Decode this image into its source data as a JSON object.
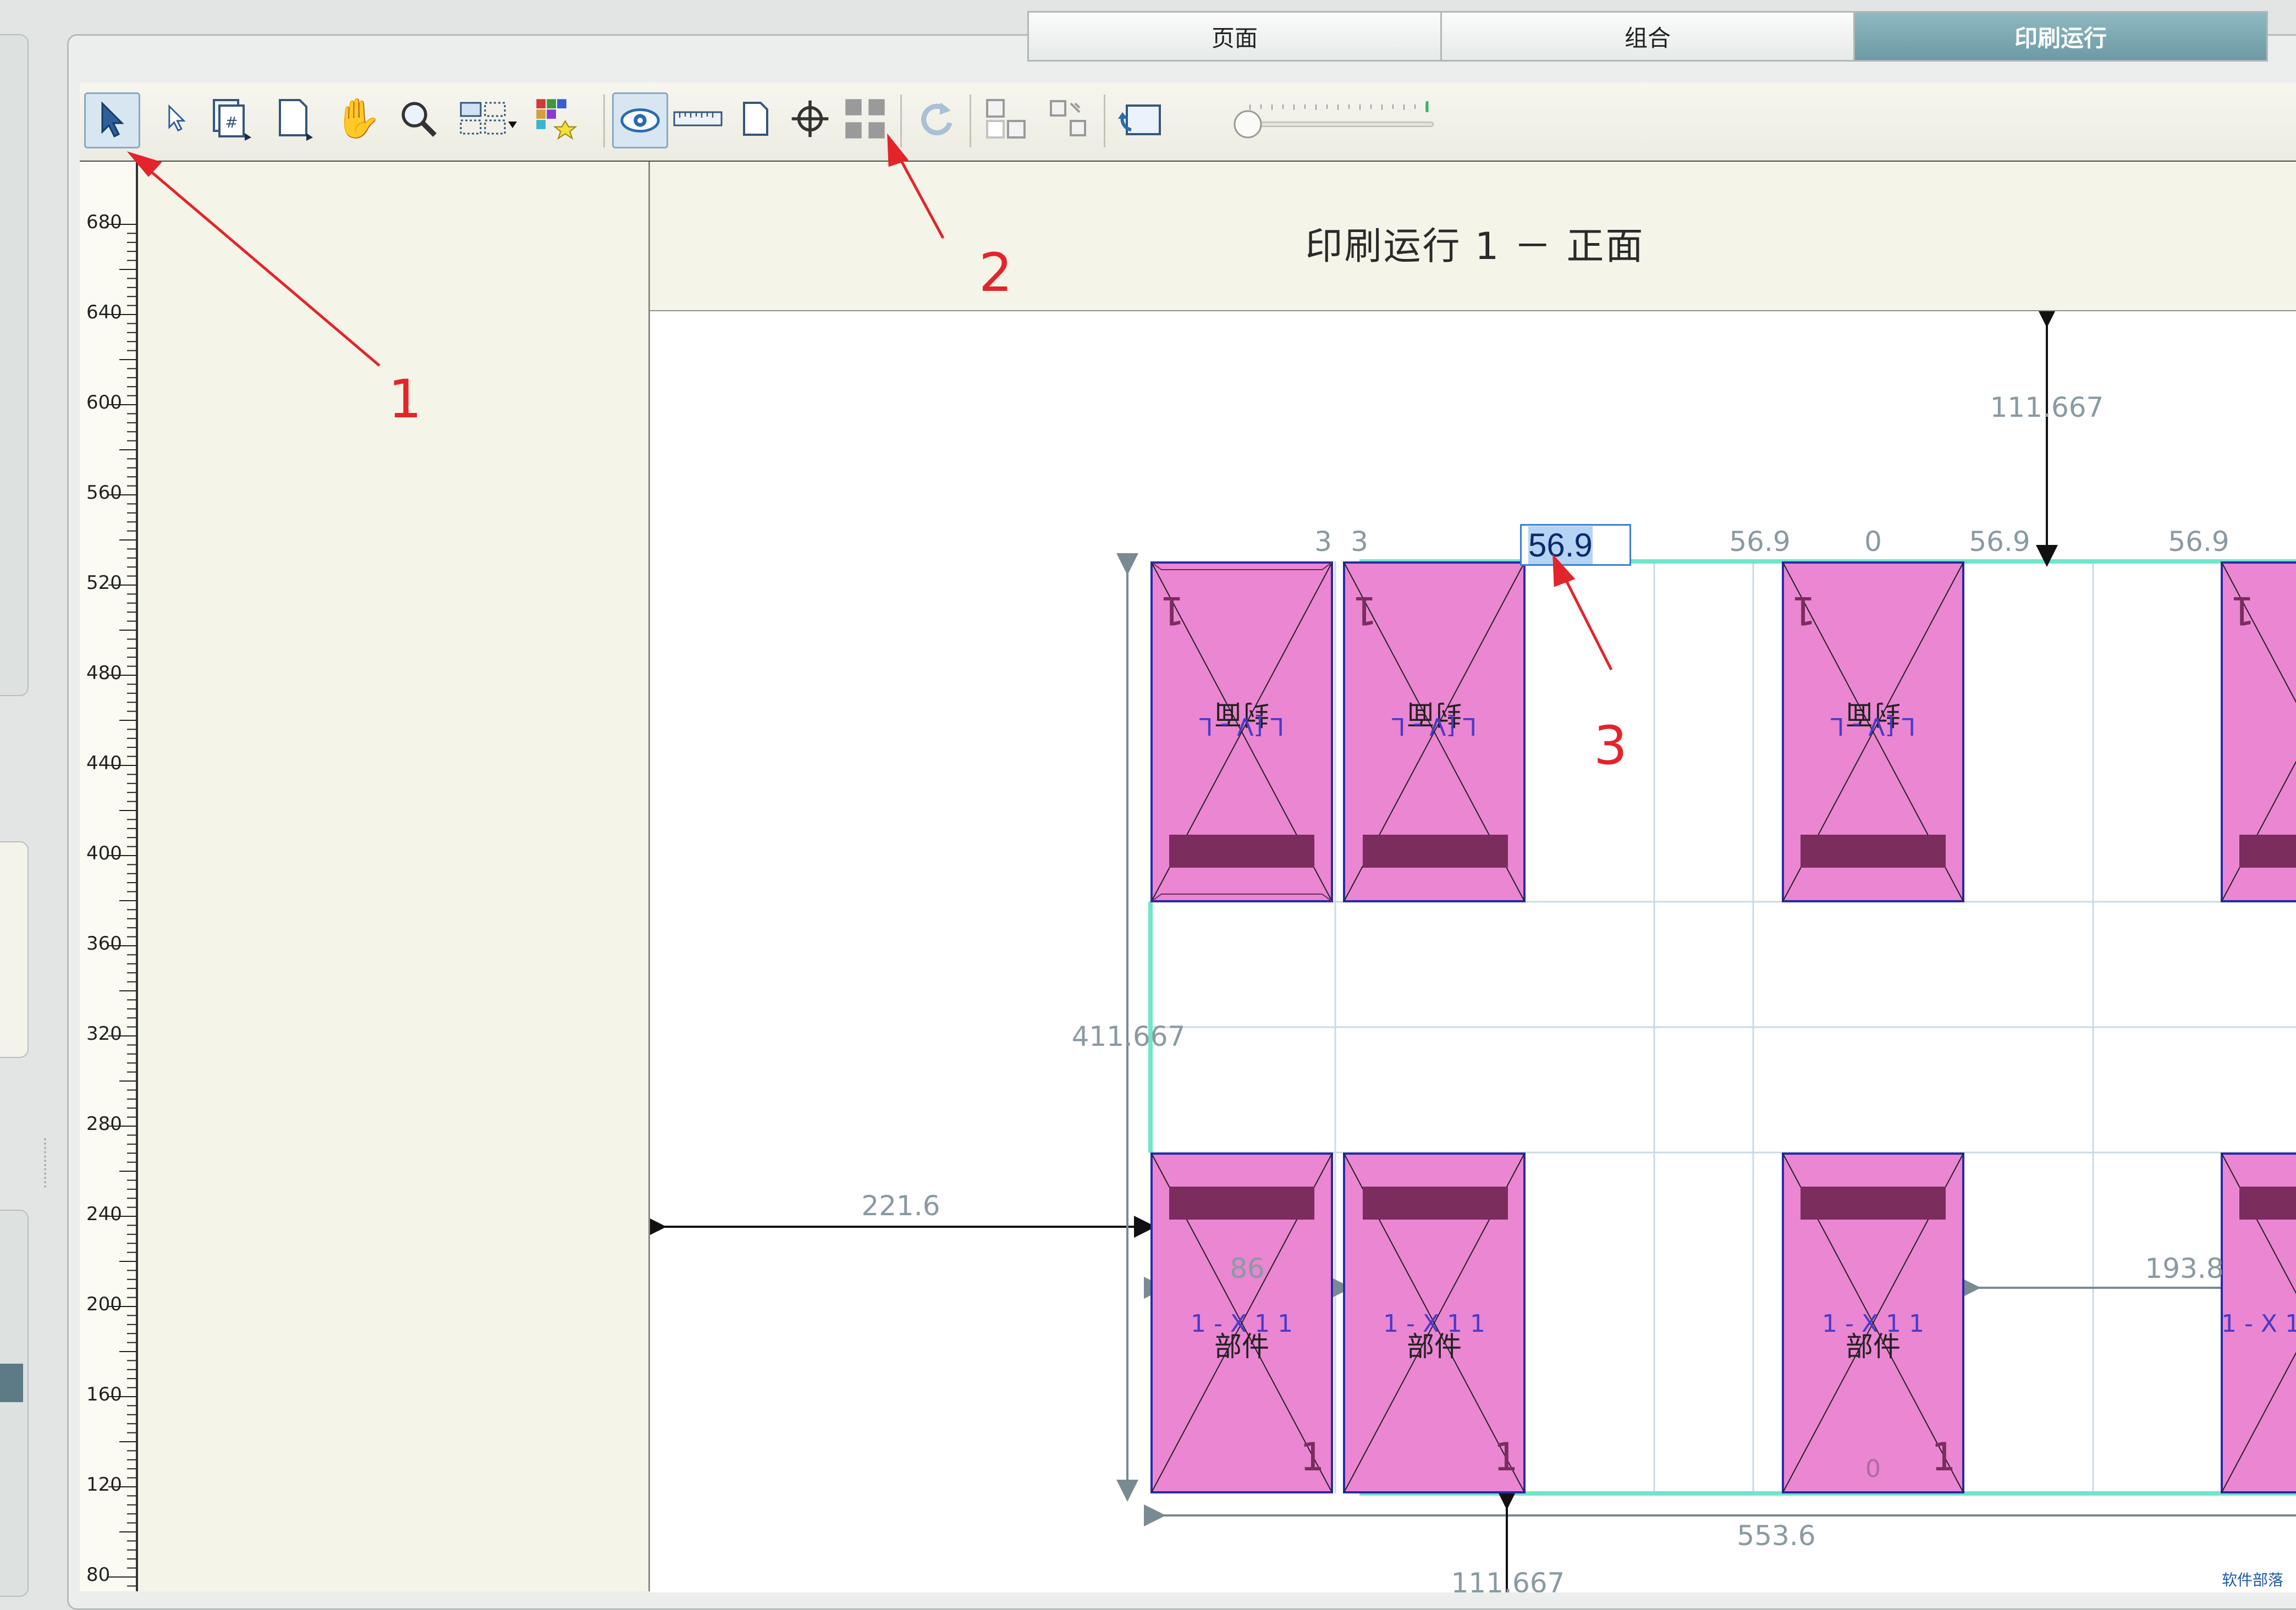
{
  "tabs": [
    {
      "label": "页面",
      "active": false
    },
    {
      "label": "组合",
      "active": false
    },
    {
      "label": "印刷运行",
      "active": true
    }
  ],
  "toolbar": {
    "tools": [
      {
        "name": "select-tool",
        "icon": "arrow-cursor-icon",
        "pressed": true
      },
      {
        "name": "direct-select-tool",
        "icon": "small-arrow-icon"
      },
      {
        "name": "page-numbering-tool",
        "icon": "page-number-icon"
      },
      {
        "name": "page-tool",
        "icon": "page-icon"
      },
      {
        "name": "hand-tool",
        "icon": "hand-icon"
      },
      {
        "name": "zoom-tool",
        "icon": "magnifier-icon"
      },
      {
        "name": "layout-grid-tool",
        "icon": "grid-dropdown-icon"
      },
      {
        "name": "color-magic-tool",
        "icon": "color-wand-icon"
      },
      {
        "name": "preview-toggle",
        "icon": "eye-icon",
        "pressed": true
      },
      {
        "name": "ruler-toggle",
        "icon": "ruler-icon"
      },
      {
        "name": "sheet-view",
        "icon": "sheet-icon"
      },
      {
        "name": "registration-mark",
        "icon": "crosshair-icon"
      },
      {
        "name": "gap-tool",
        "icon": "gap-crop-icon"
      },
      {
        "name": "rotate",
        "icon": "rotate-icon"
      },
      {
        "name": "align-a",
        "icon": "align-grid-icon"
      },
      {
        "name": "align-b",
        "icon": "distribute-icon"
      },
      {
        "name": "undo-layout",
        "icon": "undo-sheet-icon"
      }
    ],
    "zoom_slider_value": 0
  },
  "ruler": {
    "labels": [
      "680",
      "640",
      "600",
      "560",
      "520",
      "480",
      "440",
      "400",
      "360",
      "320",
      "280",
      "240",
      "200",
      "160",
      "120",
      "80"
    ]
  },
  "sheet": {
    "title": "印刷运行 1 － 正面"
  },
  "dimensions": {
    "top_margin": "111.667",
    "left_margin": "221.6",
    "sheet_height": "411.667",
    "sheet_width": "553.6",
    "gap_a": "3",
    "gap_b": "3",
    "col_spacing_1": "56.9",
    "col_spacing_2": "0",
    "col_spacing_3": "56.9",
    "col_spacing_4": "56.9",
    "cell_width": "86",
    "right_offset": "193.8",
    "bottom_partial": "111.667",
    "zero_label": "0"
  },
  "edit_field": {
    "value": "56.9"
  },
  "tiles": {
    "top_label": "封面",
    "top_code": "L [V - L",
    "bottom_label": "部件",
    "bottom_code": "1 - X 1 1",
    "corner": "1"
  },
  "annotations": [
    "1",
    "2",
    "3"
  ],
  "watermark": "软件部落",
  "colors": {
    "accent_tab": "#7aa7b1",
    "tile_fill": "#ea86d2",
    "tile_bar": "#7b2d5e",
    "tile_border": "#2a2aa8",
    "sheet_edge": "#6fe6c9",
    "annotation": "#e3242b"
  }
}
